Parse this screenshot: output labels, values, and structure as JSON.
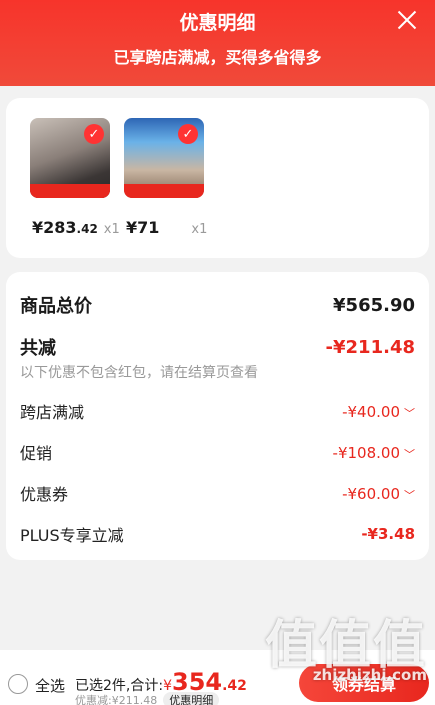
{
  "header": {
    "title": "优惠明细",
    "subtitle": "已享跨店满减，买得多省得多"
  },
  "products": [
    {
      "price_int": "¥283",
      "price_dec": ".42",
      "qty": "x1"
    },
    {
      "price_int": "¥71",
      "price_dec": "",
      "qty": "x1"
    }
  ],
  "details": {
    "total_label": "商品总价",
    "total_value": "¥565.90",
    "reduce_label": "共减",
    "reduce_value": "-¥211.48",
    "note": "以下优惠不包含红包，请在结算页查看",
    "items": [
      {
        "label": "跨店满减",
        "value": "-¥40.00",
        "chevron": "chevron-down-icon"
      },
      {
        "label": "促销",
        "value": "-¥108.00",
        "chevron": "chevron-down-icon"
      },
      {
        "label": "优惠券",
        "value": "-¥60.00",
        "chevron": "chevron-down-icon"
      },
      {
        "label": "PLUS专享立减",
        "value": "-¥3.48"
      }
    ]
  },
  "bottom": {
    "select_all": "全选",
    "selected_text": "已选2件,合计:",
    "sum_prefix": "¥",
    "sum_int": "354",
    "sum_dec": ".42",
    "reduce_text": "优惠减:¥211.48",
    "detail_tag": "优惠明细",
    "checkout": "领券结算"
  },
  "watermark": {
    "line1": "值值值",
    "line2": "zhizhizhi.com"
  },
  "colors": {
    "accent": "#e8271e",
    "header": "#f7342b"
  }
}
